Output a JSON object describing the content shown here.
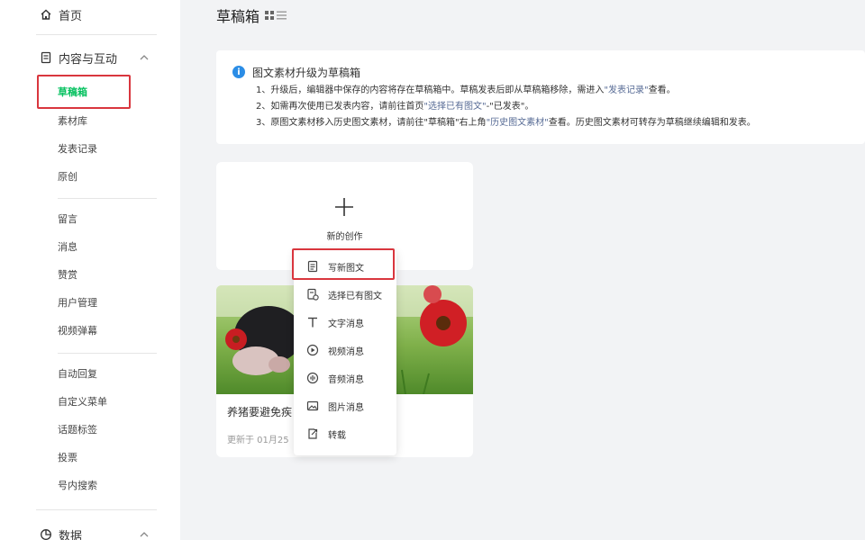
{
  "sidebar": {
    "home": "首页",
    "content_group": "内容与互动",
    "content_items": [
      "草稿箱",
      "素材库",
      "发表记录",
      "原创"
    ],
    "interact_items": [
      "留言",
      "消息",
      "赞赏",
      "用户管理",
      "视频弹幕"
    ],
    "feature_items": [
      "自动回复",
      "自定义菜单",
      "话题标签",
      "投票",
      "号内搜索"
    ],
    "data_group": "数据"
  },
  "header": {
    "title": "草稿箱"
  },
  "notice": {
    "title": "图文素材升级为草稿箱",
    "line1_a": "1、升级后，编辑器中保存的内容将存在草稿箱中。草稿发表后即从草稿箱移除，需进入",
    "line1_link": "\"发表记录\"",
    "line1_b": "查看。",
    "line2_a": "2、如需再次使用已发表内容，请前往首页",
    "line2_link": "\"选择已有图文\"",
    "line2_b": "-\"已发表\"。",
    "line3_a": "3、原图文素材移入历史图文素材，请前往\"草稿箱\"右上角",
    "line3_link": "\"历史图文素材\"",
    "line3_b": "查看。历史图文素材可转存为草稿继续编辑和发表。"
  },
  "create": {
    "label": "新的创作"
  },
  "article": {
    "title": "养猪要避免疾",
    "date": "更新于 01月25"
  },
  "menu": {
    "items": [
      "写新图文",
      "选择已有图文",
      "文字消息",
      "视频消息",
      "音频消息",
      "图片消息",
      "转载"
    ]
  },
  "colors": {
    "accent": "#07c160",
    "highlight": "#d9363e",
    "link": "#576b95",
    "info": "#2b8de6"
  }
}
